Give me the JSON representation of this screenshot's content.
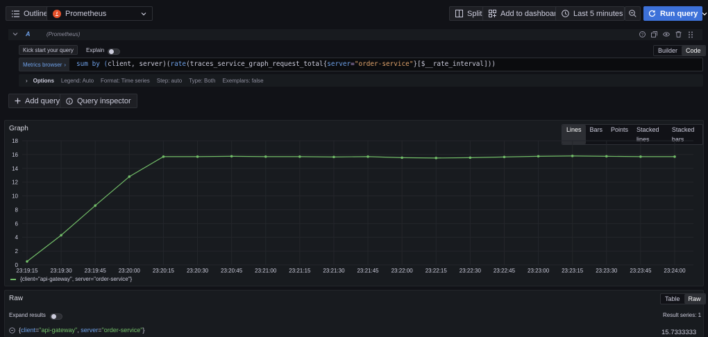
{
  "toolbar": {
    "outline_label": "Outline",
    "datasource_label": "Prometheus",
    "split_label": "Split",
    "add_dashboard_label": "Add to dashboard",
    "time_range_label": "Last 5 minutes",
    "run_query_label": "Run query"
  },
  "query": {
    "ref_id": "A",
    "datasource_hint": "(Prometheus)",
    "kickstart_label": "Kick start your query",
    "explain_label": "Explain",
    "builder_label": "Builder",
    "code_label": "Code",
    "metrics_browser_label": "Metrics browser",
    "expr": {
      "p1": "sum by (",
      "p2": "client",
      "p3": ", ",
      "p4": "server",
      "p5": ")(",
      "p6": "rate",
      "p7": "(traces_service_graph_request_total{",
      "p8": "server",
      "p9": "=",
      "p10": "\"order-service\"",
      "p11": "}[$__rate_interval]))"
    },
    "options": {
      "label": "Options",
      "legend": "Legend: Auto",
      "format": "Format: Time series",
      "step": "Step: auto",
      "type": "Type: Both",
      "exemplars": "Exemplars: false"
    },
    "add_query_label": "Add query",
    "inspector_label": "Query inspector"
  },
  "graph": {
    "title": "Graph",
    "modes": [
      "Lines",
      "Bars",
      "Points",
      "Stacked lines",
      "Stacked bars"
    ],
    "active_mode": "Lines",
    "legend_label": "{client=\"api-gateway\", server=\"order-service\"}"
  },
  "chart_data": {
    "type": "line",
    "title": "",
    "xlabel": "",
    "ylabel": "",
    "ylim": [
      0,
      18
    ],
    "yticks": [
      0,
      2,
      4,
      6,
      8,
      10,
      12,
      14,
      16,
      18
    ],
    "xticks": [
      "23:19:15",
      "23:19:30",
      "23:19:45",
      "23:20:00",
      "23:20:15",
      "23:20:30",
      "23:20:45",
      "23:21:00",
      "23:21:15",
      "23:21:30",
      "23:21:45",
      "23:22:00",
      "23:22:15",
      "23:22:30",
      "23:22:45",
      "23:23:00",
      "23:23:15",
      "23:23:30",
      "23:23:45",
      "23:24:00"
    ],
    "grid": true,
    "color": "#73bf69",
    "series": [
      {
        "name": "{client=\"api-gateway\", server=\"order-service\"}",
        "x": [
          "23:19:15",
          "23:19:30",
          "23:19:45",
          "23:20:00",
          "23:20:15",
          "23:20:30",
          "23:20:45",
          "23:21:00",
          "23:21:15",
          "23:21:30",
          "23:21:45",
          "23:22:00",
          "23:22:15",
          "23:22:30",
          "23:22:45",
          "23:23:00",
          "23:23:15",
          "23:23:30",
          "23:23:45",
          "23:24:00"
        ],
        "values": [
          0.5,
          4.3,
          8.6,
          12.8,
          15.7,
          15.7,
          15.75,
          15.7,
          15.7,
          15.65,
          15.7,
          15.55,
          15.5,
          15.55,
          15.65,
          15.75,
          15.8,
          15.75,
          15.7,
          15.7
        ]
      }
    ]
  },
  "raw": {
    "title": "Raw",
    "table_label": "Table",
    "raw_label": "Raw",
    "expand_label": "Expand results",
    "result_series": "Result series: 1",
    "row": {
      "open": "{",
      "k1": "client",
      "eq1": "=",
      "v1": "\"api-gateway\"",
      "sep": ", ",
      "k2": "server",
      "eq2": "=",
      "v2": "\"order-service\"",
      "close": "}"
    },
    "value": "15.7333333"
  },
  "colors": {
    "accent": "#3d71d9",
    "series": "#73bf69",
    "label_key": "#6ea0e8",
    "string_value": "#73bf69"
  }
}
